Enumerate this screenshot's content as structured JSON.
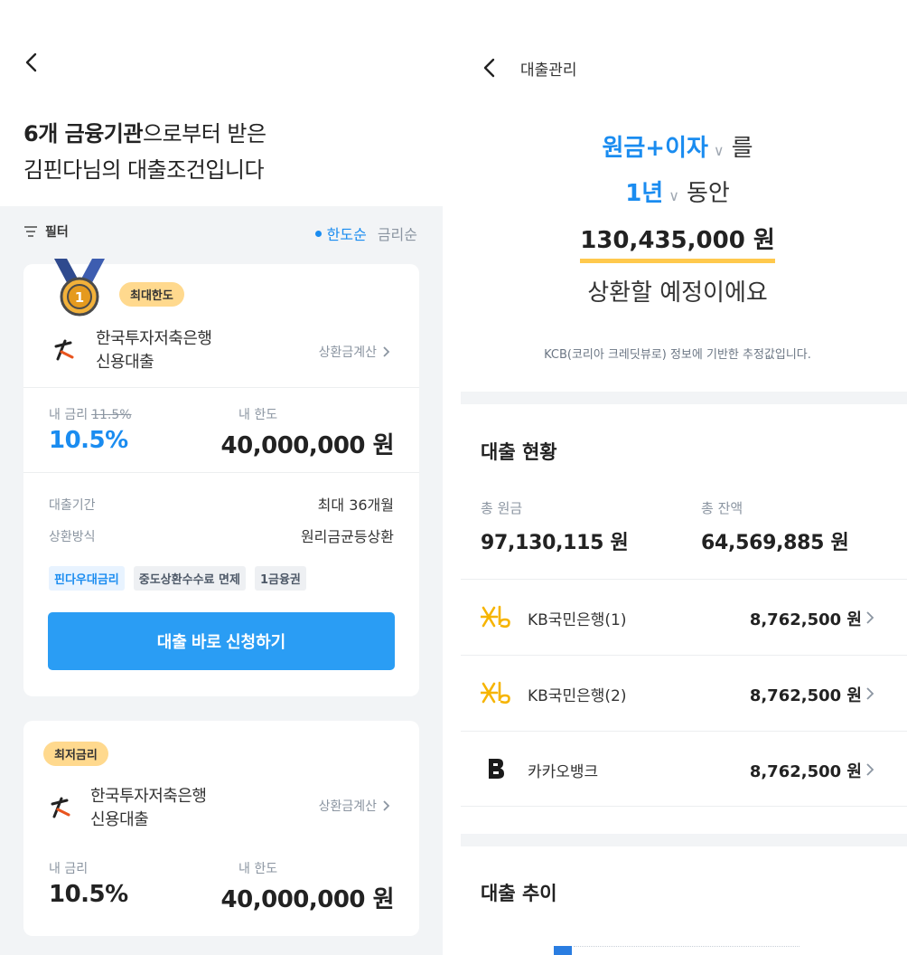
{
  "left": {
    "headline": {
      "bold": "6개 금융기관",
      "rest1": "으로부터 받은",
      "line2": "김핀다님의 대출조건입니다"
    },
    "filter_label": "필터",
    "sort": {
      "active": "한도순",
      "inactive": "금리순"
    },
    "cards": [
      {
        "badge": "최대한도",
        "medal_number": "1",
        "bank_line1": "한국투자저축은행",
        "bank_line2": "신용대출",
        "calc_link": "상환금계산",
        "rate_label": "내 금리",
        "old_rate": "11.5%",
        "rate": "10.5%",
        "limit_label": "내 한도",
        "limit": "40,000,000 원",
        "term_label": "대출기간",
        "term_value": "최대 36개월",
        "method_label": "상환방식",
        "method_value": "원리금균등상환",
        "tags": [
          "핀다우대금리",
          "중도상환수수료 면제",
          "1금융권"
        ],
        "apply_button": "대출 바로 신청하기"
      },
      {
        "badge": "최저금리",
        "bank_line1": "한국투자저축은행",
        "bank_line2": "신용대출",
        "calc_link": "상환금계산",
        "rate_label": "내 금리",
        "rate": "10.5%",
        "limit_label": "내 한도",
        "limit": "40,000,000 원"
      }
    ]
  },
  "right": {
    "nav_title": "대출관리",
    "selector1": "원금+이자",
    "particle1": "를",
    "selector2": "1년",
    "particle2": "동안",
    "amount": "130,435,000 원",
    "sentence_end": "상환할 예정이에요",
    "note": "KCB(코리아 크레딧뷰로) 정보에 기반한 추정값입니다.",
    "status": {
      "title": "대출 현황",
      "principal_label": "총 원금",
      "principal_value": "97,130,115 원",
      "balance_label": "총 잔액",
      "balance_value": "64,569,885 원"
    },
    "loans": [
      {
        "name": "KB국민은행(1)",
        "amount": "8,762,500 원",
        "logo": "kb-logo-icon"
      },
      {
        "name": "KB국민은행(2)",
        "amount": "8,762,500 원",
        "logo": "kb-logo-icon"
      },
      {
        "name": "카카오뱅크",
        "amount": "8,762,500 원",
        "logo": "kakaobank-logo-icon"
      }
    ],
    "trend_title": "대출 추이"
  },
  "colors": {
    "accent": "#1a8cf0",
    "button": "#2a9df4",
    "badge": "#ffd98e",
    "highlight": "#ffc94d"
  }
}
